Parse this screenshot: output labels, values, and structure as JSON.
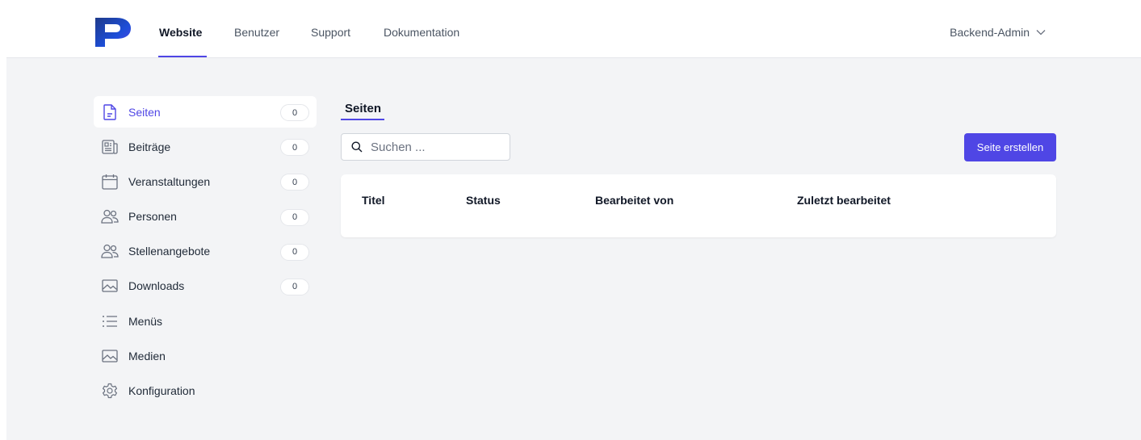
{
  "header": {
    "tabs": [
      {
        "label": "Website",
        "active": true
      },
      {
        "label": "Benutzer"
      },
      {
        "label": "Support"
      },
      {
        "label": "Dokumentation"
      }
    ],
    "user_menu": {
      "label": "Backend-Admin",
      "icon": "chevron-down-icon"
    }
  },
  "sidebar": {
    "items": [
      {
        "label": "Seiten",
        "icon": "document-icon",
        "count": "0",
        "active": true
      },
      {
        "label": "Beiträge",
        "icon": "newspaper-icon",
        "count": "0"
      },
      {
        "label": "Veranstaltungen",
        "icon": "calendar-icon",
        "count": "0"
      },
      {
        "label": "Personen",
        "icon": "users-icon",
        "count": "0"
      },
      {
        "label": "Stellenangebote",
        "icon": "users-icon",
        "count": "0"
      },
      {
        "label": "Downloads",
        "icon": "image-icon",
        "count": "0"
      },
      {
        "label": "Menüs",
        "icon": "list-icon"
      },
      {
        "label": "Medien",
        "icon": "image-icon"
      },
      {
        "label": "Konfiguration",
        "icon": "gear-icon"
      }
    ]
  },
  "main": {
    "title": "Seiten",
    "search": {
      "placeholder": "Suchen ..."
    },
    "create_button": "Seite erstellen",
    "table": {
      "columns": [
        "Titel",
        "Status",
        "Bearbeitet von",
        "Zuletzt bearbeitet"
      ],
      "rows": []
    }
  },
  "colors": {
    "accent": "#4f46e5",
    "background": "#f3f4f6",
    "logo_dark": "#0b1f6e"
  }
}
